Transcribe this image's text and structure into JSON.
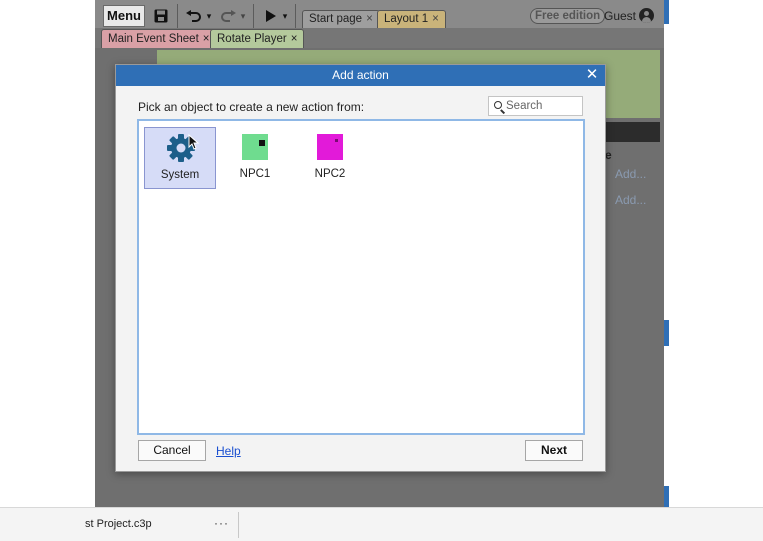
{
  "toolbar": {
    "menu_label": "Menu",
    "save_icon": "floppy-disk-icon",
    "undo_icon": "undo-arrow-icon",
    "redo_icon": "redo-arrow-icon",
    "play_icon": "play-icon",
    "dropdown_glyph": "▾",
    "tabs": [
      {
        "label": "Start page",
        "color": "#9e9e9e"
      },
      {
        "label": "Layout 1",
        "color": "#c9b37a"
      }
    ],
    "close_glyph": "×",
    "edition_badge": "Free edition",
    "user_label": "Guest"
  },
  "sheet_tabs": [
    {
      "label": "Main Event Sheet",
      "color": "#d9a0a6"
    },
    {
      "label": "Rotate Player",
      "color": "#b4c99c"
    }
  ],
  "background": {
    "section_letter": "e",
    "add_links": [
      "Add...",
      "Add..."
    ]
  },
  "dialog": {
    "title": "Add action",
    "close_glyph": "✕",
    "prompt": "Pick an object to create a new action from:",
    "search_placeholder": "Search",
    "objects": [
      {
        "label": "System",
        "icon": "gear-icon",
        "selected": true,
        "color": "#1d5f8a"
      },
      {
        "label": "NPC1",
        "icon": "sprite-swatch",
        "selected": false,
        "color": "#6fdc8f"
      },
      {
        "label": "NPC2",
        "icon": "sprite-swatch",
        "selected": false,
        "color": "#e21ad9"
      }
    ],
    "cancel_label": "Cancel",
    "help_label": "Help",
    "next_label": "Next"
  },
  "status_bar": {
    "file_name": "st Project.c3p",
    "more_glyph": "···"
  },
  "colors": {
    "title_bar": "#2f6fb6",
    "list_border": "#8fb8e6",
    "selection": "#d6dcf7"
  }
}
